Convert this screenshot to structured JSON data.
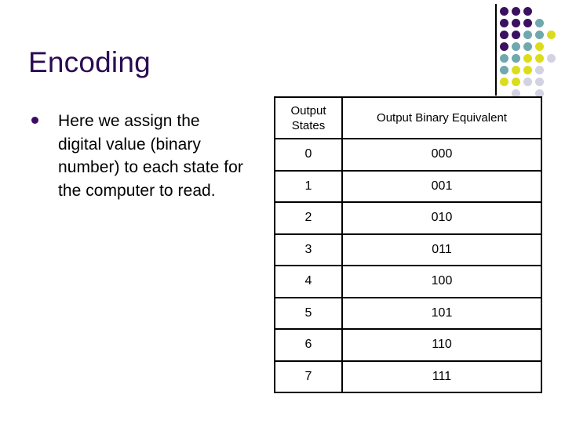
{
  "slide": {
    "title": "Encoding",
    "title_color": "#2c0a52",
    "background_color": "#ffffff"
  },
  "body": {
    "bullet_marker": "disc",
    "bullet_color": "#3a0b63",
    "bullet_text": "Here we assign the digital value (binary number) to each state for the computer to read."
  },
  "table": {
    "headers": [
      "Output States",
      "Output Binary Equivalent"
    ],
    "rows": [
      {
        "state": "0",
        "binary": "000"
      },
      {
        "state": "1",
        "binary": "001"
      },
      {
        "state": "2",
        "binary": "010"
      },
      {
        "state": "3",
        "binary": "011"
      },
      {
        "state": "4",
        "binary": "100"
      },
      {
        "state": "5",
        "binary": "101"
      },
      {
        "state": "6",
        "binary": "110"
      },
      {
        "state": "7",
        "binary": "111"
      }
    ],
    "border_color": "#000000",
    "text_color": "#000000"
  },
  "decoration": {
    "name": "corner-dot-motif",
    "rule_color": "#000000",
    "palette": {
      "purple": "#3b1060",
      "teal": "#6fa8ad",
      "yellow": "#dcdc1e",
      "lavender": "#d2d2e2"
    },
    "grid": [
      [
        "purple",
        "purple",
        "purple",
        null,
        null
      ],
      [
        "purple",
        "purple",
        "purple",
        "teal",
        null
      ],
      [
        "purple",
        "purple",
        "teal",
        "teal",
        "yellow"
      ],
      [
        "purple",
        "teal",
        "teal",
        "yellow",
        null
      ],
      [
        "teal",
        "teal",
        "yellow",
        "yellow",
        "lavender"
      ],
      [
        "teal",
        "yellow",
        "yellow",
        "lavender",
        null
      ],
      [
        "yellow",
        "yellow",
        "lavender",
        "lavender",
        null
      ],
      [
        null,
        "lavender",
        null,
        "lavender",
        null
      ]
    ],
    "cell_size": 15,
    "dot_size": 11
  }
}
